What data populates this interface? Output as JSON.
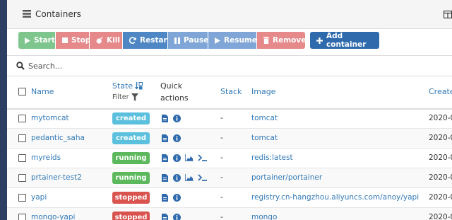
{
  "panel": {
    "title": "Containers",
    "title_icon": "list-icon",
    "corner_icon": "grid-icon"
  },
  "toolbar": {
    "start": "Start",
    "stop": "Stop",
    "kill": "Kill",
    "restart": "Restart",
    "pause": "Pause",
    "resume": "Resume",
    "remove": "Remove",
    "add": "Add container"
  },
  "search": {
    "placeholder": "Search...",
    "value": ""
  },
  "table": {
    "headers": {
      "name": "Name",
      "state": "State",
      "filter": "Filter",
      "quick_actions_1": "Quick",
      "quick_actions_2": "actions",
      "stack": "Stack",
      "image": "Image",
      "created": "Create"
    },
    "rows": [
      {
        "name": "mytomcat",
        "state": "created",
        "stack": "-",
        "image": "tomcat",
        "created": "2020-0",
        "actions": [
          "logs",
          "inspect"
        ]
      },
      {
        "name": "pedantic_saha",
        "state": "created",
        "stack": "-",
        "image": "tomcat",
        "created": "2020-0",
        "actions": [
          "logs",
          "inspect"
        ]
      },
      {
        "name": "myreids",
        "state": "running",
        "stack": "-",
        "image": "redis:latest",
        "created": "2020-0",
        "actions": [
          "logs",
          "inspect",
          "stats",
          "console"
        ]
      },
      {
        "name": "prtainer-test2",
        "state": "running",
        "stack": "-",
        "image": "portainer/portainer",
        "created": "2020-0",
        "actions": [
          "logs",
          "inspect",
          "stats",
          "console"
        ]
      },
      {
        "name": "yapi",
        "state": "stopped",
        "stack": "-",
        "image": "registry.cn-hangzhou.aliyuncs.com/anoy/yapi",
        "created": "2020-0",
        "actions": [
          "logs",
          "inspect"
        ]
      },
      {
        "name": "mongo-yapi",
        "state": "stopped",
        "stack": "-",
        "image": "mongo",
        "created": "2020-0",
        "actions": [
          "logs",
          "inspect"
        ]
      }
    ]
  },
  "colors": {
    "created": "#5bc0de",
    "running": "#5cb85c",
    "stopped": "#d9534f",
    "link": "#337ab7",
    "background": "#2d3e63"
  }
}
